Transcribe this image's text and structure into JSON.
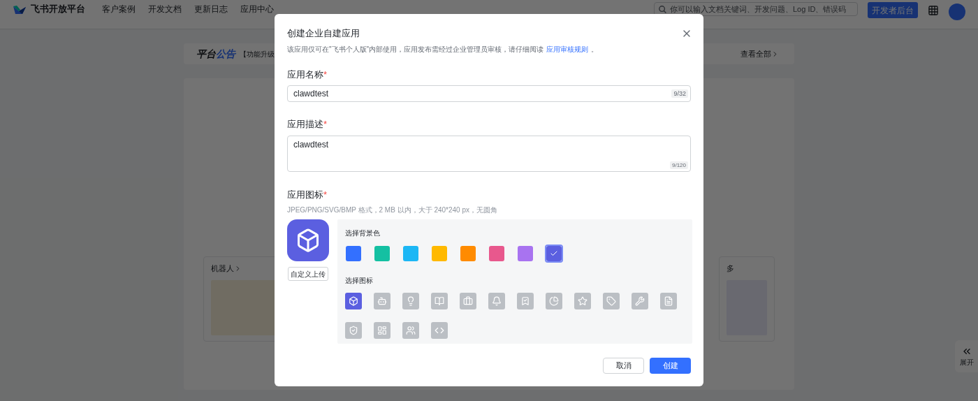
{
  "header": {
    "logo_text": "飞书开放平台",
    "nav": [
      {
        "label": "客户案例"
      },
      {
        "label": "开发文档"
      },
      {
        "label": "更新日志"
      },
      {
        "label": "应用中心"
      }
    ],
    "search": {
      "placeholder": "你可以输入文档关键词、开发问题、Log ID、错误码"
    },
    "console_button": "开发者后台"
  },
  "announcement": {
    "title": "平台",
    "title_highlight": "公告",
    "text": "【功能升级",
    "view_all": "查看全部"
  },
  "cards": [
    {
      "title": "机器人"
    },
    {
      "title": "多"
    }
  ],
  "side_tab": {
    "label": "展开"
  },
  "dialog": {
    "title": "创建企业自建应用",
    "notice": "该应用仅可在\"飞书个人版\"内部使用，应用发布需经过企业管理员审核，请仔细阅读",
    "notice_link": "应用审核规则",
    "notice_end": "。",
    "name_field": {
      "label": "应用名称",
      "required_mark": "*",
      "value": "clawdtest",
      "counter": "9/32"
    },
    "desc_field": {
      "label": "应用描述",
      "required_mark": "*",
      "value": "clawdtest",
      "counter": "9/120"
    },
    "icon_field": {
      "label": "应用图标",
      "required_mark": "*",
      "hint": "JPEG/PNG/SVG/BMP 格式，2 MB 以内，大于 240*240 px，无圆角",
      "upload_button": "自定义上传",
      "color_title": "选择背景色",
      "colors": [
        {
          "color": "#3370ff",
          "selected": false
        },
        {
          "color": "#14c0a2",
          "selected": false
        },
        {
          "color": "#1cb7f5",
          "selected": false
        },
        {
          "color": "#ffb900",
          "selected": false
        },
        {
          "color": "#ff8b00",
          "selected": false
        },
        {
          "color": "#e8588d",
          "selected": false
        },
        {
          "color": "#a873f0",
          "selected": false
        },
        {
          "color": "#5b5fe0",
          "selected": true
        }
      ],
      "icon_title": "选择图标",
      "icons": [
        {
          "selected": true
        },
        {
          "selected": false
        },
        {
          "selected": false
        },
        {
          "selected": false
        },
        {
          "selected": false
        },
        {
          "selected": false
        },
        {
          "selected": false
        },
        {
          "selected": false
        },
        {
          "selected": false
        },
        {
          "selected": false
        },
        {
          "selected": false
        },
        {
          "selected": false
        },
        {
          "selected": false
        },
        {
          "selected": false
        },
        {
          "selected": false
        },
        {
          "selected": false
        }
      ]
    },
    "cancel_button": "取消",
    "create_button": "创建"
  }
}
